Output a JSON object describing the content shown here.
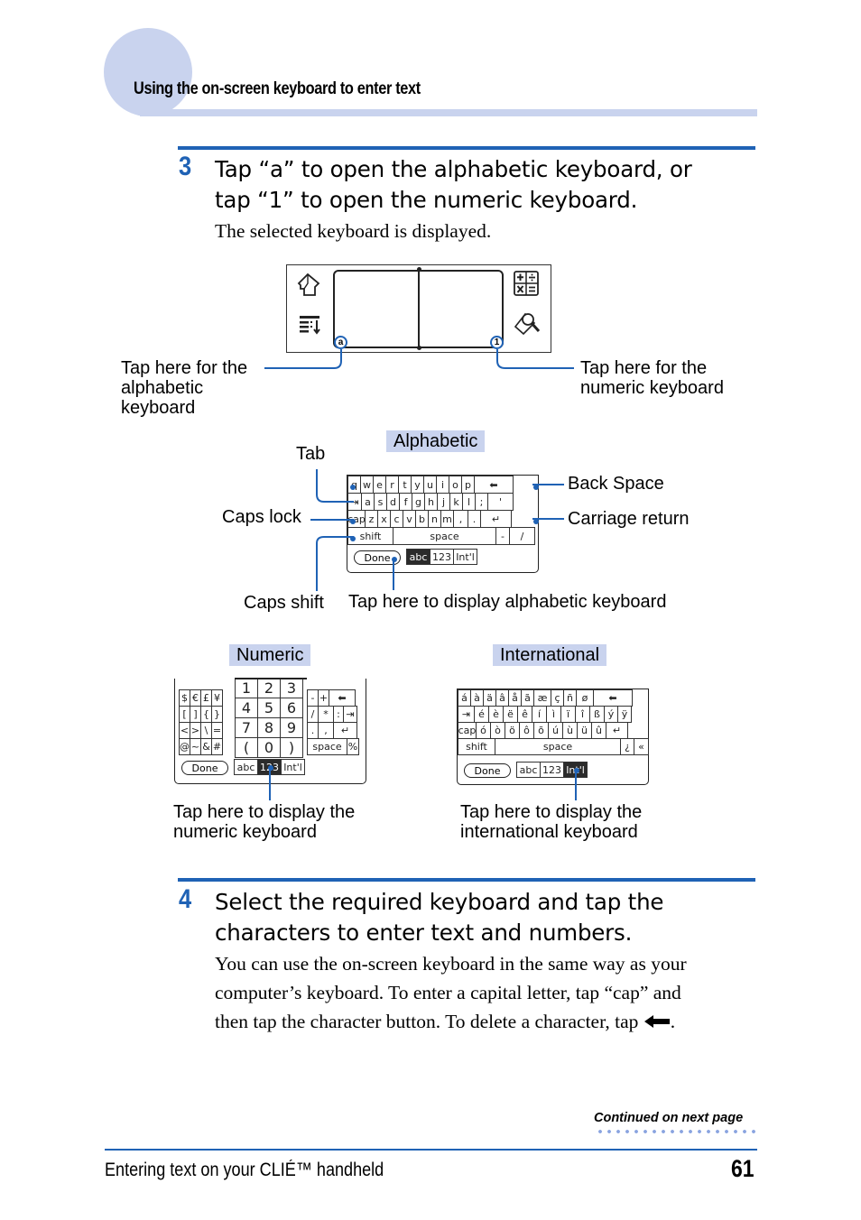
{
  "header": {
    "section_title": "Using the on-screen keyboard to enter text"
  },
  "step3": {
    "number": "3",
    "title_line1": "Tap “a” to open the alphabetic keyboard, or",
    "title_line2": "tap “1” to open the numeric keyboard.",
    "body": "The selected keyboard is displayed."
  },
  "device": {
    "alpha_button": "a",
    "numeric_button": "1",
    "icons": [
      "home-icon",
      "menu-icon",
      "calculator-icon",
      "find-icon"
    ],
    "callout_alpha": [
      "Tap here for the",
      "alphabetic",
      "keyboard"
    ],
    "callout_numeric": [
      "Tap here for the",
      "numeric keyboard"
    ]
  },
  "alphabetic": {
    "tag": "Alphabetic",
    "rows": [
      [
        "q",
        "w",
        "e",
        "r",
        "t",
        "y",
        "u",
        "i",
        "o",
        "p",
        "⬅"
      ],
      [
        "⇥",
        "a",
        "s",
        "d",
        "f",
        "g",
        "h",
        "j",
        "k",
        "l",
        ";",
        "'"
      ],
      [
        "cap",
        "z",
        "x",
        "c",
        "v",
        "b",
        "n",
        "m",
        ",",
        ".",
        "↵"
      ],
      [
        "shift",
        "space",
        "-",
        "/"
      ]
    ],
    "bottom": {
      "done": "Done",
      "modes": [
        "abc",
        "123",
        "Int'l"
      ],
      "selected": "abc"
    },
    "callouts": {
      "tab": "Tab",
      "caps_lock": "Caps lock",
      "caps_shift": "Caps shift",
      "back_space": "Back Space",
      "carriage_return": "Carriage return",
      "display_alpha": "Tap here to display alphabetic keyboard"
    }
  },
  "numeric": {
    "tag": "Numeric",
    "symbols": [
      [
        "$",
        "€",
        "£",
        "¥"
      ],
      [
        "[",
        "]",
        "{",
        "}"
      ],
      [
        "<",
        ">",
        "\\",
        "="
      ],
      [
        "@",
        "~",
        "&",
        "#"
      ]
    ],
    "digits": [
      [
        "1",
        "2",
        "3"
      ],
      [
        "4",
        "5",
        "6"
      ],
      [
        "7",
        "8",
        "9"
      ],
      [
        "(",
        "0",
        ")"
      ]
    ],
    "ops": [
      [
        "-",
        "+",
        "⬅"
      ],
      [
        "/",
        "*",
        ":",
        "⇥"
      ],
      [
        ".",
        ",",
        "↵"
      ],
      [
        "space",
        "%"
      ]
    ],
    "bottom": {
      "done": "Done",
      "modes": [
        "abc",
        "123",
        "Int'l"
      ],
      "selected": "123"
    },
    "callout": [
      "Tap here to display the",
      "numeric keyboard"
    ]
  },
  "international": {
    "tag": "International",
    "rows": [
      [
        "á",
        "à",
        "ä",
        "â",
        "å",
        "ã",
        "æ",
        "ç",
        "ñ",
        "ø",
        "⬅"
      ],
      [
        "⇥",
        "é",
        "è",
        "ë",
        "ê",
        "í",
        "ì",
        "ï",
        "î",
        "ß",
        "ý",
        "ÿ"
      ],
      [
        "cap",
        "ó",
        "ò",
        "ö",
        "ô",
        "õ",
        "ú",
        "ù",
        "ü",
        "û",
        "↵"
      ],
      [
        "shift",
        "space",
        "¿",
        "«"
      ]
    ],
    "bottom": {
      "done": "Done",
      "modes": [
        "abc",
        "123",
        "Int'l"
      ],
      "selected": "Int'l"
    },
    "callout": [
      "Tap here to display the",
      "international keyboard"
    ]
  },
  "step4": {
    "number": "4",
    "title_line1": "Select the required keyboard and tap the",
    "title_line2": "characters to enter text and numbers.",
    "body_line1": "You can use the on-screen keyboard in the same way as your",
    "body_line2": "computer’s keyboard. To enter a capital letter, tap “cap” and",
    "body_line3": "then tap the character button. To delete a character, tap",
    "body_icon": "backspace-arrow-icon",
    "body_end": "."
  },
  "footer": {
    "continued": "Continued on next page",
    "book_title": "Entering text on your CLIÉ™ handheld",
    "page_number": "61"
  },
  "colors": {
    "accent_blue": "#1f62b5",
    "tag_lavender": "#c9d3ee"
  }
}
